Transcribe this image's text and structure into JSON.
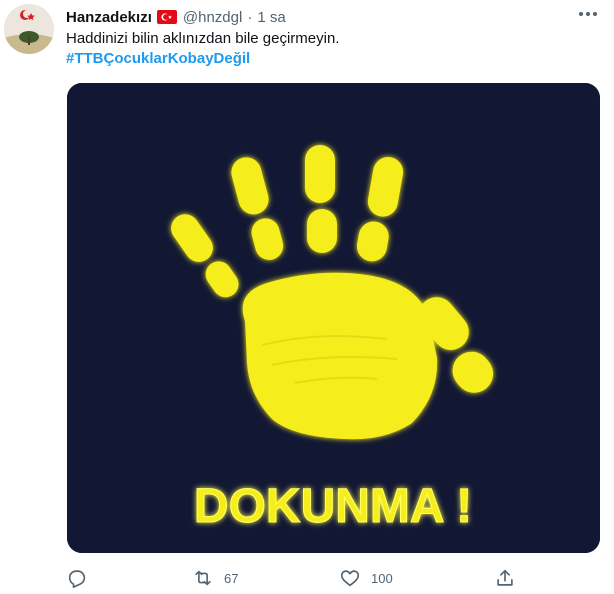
{
  "tweet": {
    "display_name": "Hanzadekızı",
    "handle": "@hnzdgl",
    "separator": "·",
    "time": "1 sa",
    "text": "Haddinizi bilin aklınızdan bile geçirmeyin.",
    "hashtag": "#TTBÇocuklarKobayDeğil",
    "media_caption": "DOKUNMA !"
  },
  "icons": {
    "flag": "turkey-flag-icon",
    "more": "more-options-icon",
    "reply": "reply-icon",
    "retweet": "retweet-icon",
    "like": "heart-icon",
    "share": "share-icon"
  },
  "actions": {
    "retweet_count": "67",
    "like_count": "100"
  },
  "colors": {
    "accent": "#1d9bf0",
    "secondary_text": "#536471",
    "media_background": "#121734",
    "hand_yellow": "#f6ee1e"
  }
}
